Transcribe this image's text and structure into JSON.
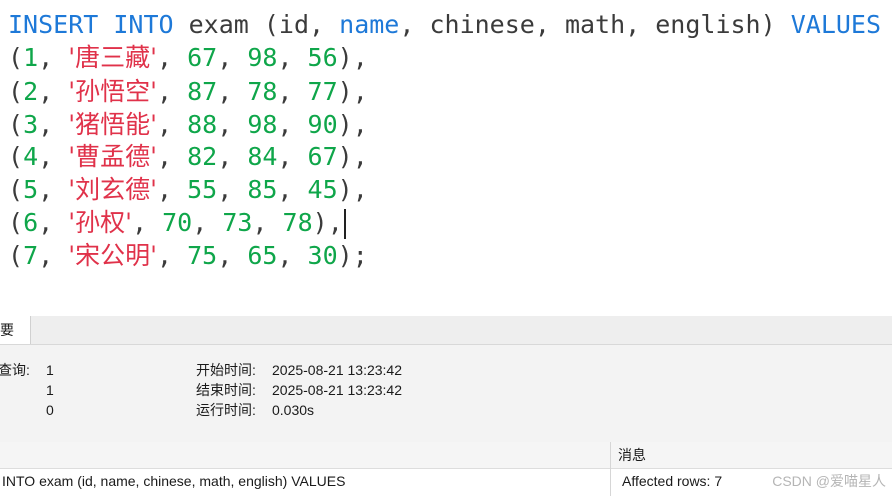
{
  "editor": {
    "header": {
      "kw_insert": "INSERT INTO",
      "table": " exam (id, ",
      "kw_name": "name",
      "cols": ", chinese, math, english) ",
      "kw_values": "VALUES"
    },
    "rows": [
      {
        "id": "1",
        "name": "'唐三藏'",
        "chinese": "67",
        "math": "98",
        "english": "56",
        "end": "),"
      },
      {
        "id": "2",
        "name": "'孙悟空'",
        "chinese": "87",
        "math": "78",
        "english": "77",
        "end": "),"
      },
      {
        "id": "3",
        "name": "'猪悟能'",
        "chinese": "88",
        "math": "98",
        "english": "90",
        "end": "),"
      },
      {
        "id": "4",
        "name": "'曹孟德'",
        "chinese": "82",
        "math": "84",
        "english": "67",
        "end": "),"
      },
      {
        "id": "5",
        "name": "'刘玄德'",
        "chinese": "55",
        "math": "85",
        "english": "45",
        "end": "),"
      },
      {
        "id": "6",
        "name": "'孙权'",
        "chinese": "70",
        "math": "73",
        "english": "78",
        "end": "),"
      },
      {
        "id": "7",
        "name": "'宋公明'",
        "chinese": "75",
        "math": "65",
        "english": "30",
        "end": ");"
      }
    ]
  },
  "result": {
    "tab_label": "摘要",
    "query_label": "查询:",
    "query_value": "1",
    "value2": "1",
    "value3": "0",
    "start_label": "开始时间:",
    "start_value": "2025-08-21 13:23:42",
    "end_label": "结束时间:",
    "end_value": "2025-08-21 13:23:42",
    "run_label": "运行时间:",
    "run_value": "0.030s",
    "grid_col_message": "消息",
    "grid_row_sql": "INTO exam (id, name, chinese, math, english) VALUES",
    "grid_row_message": "Affected rows: 7"
  },
  "watermark": "CSDN @爱喵星人"
}
